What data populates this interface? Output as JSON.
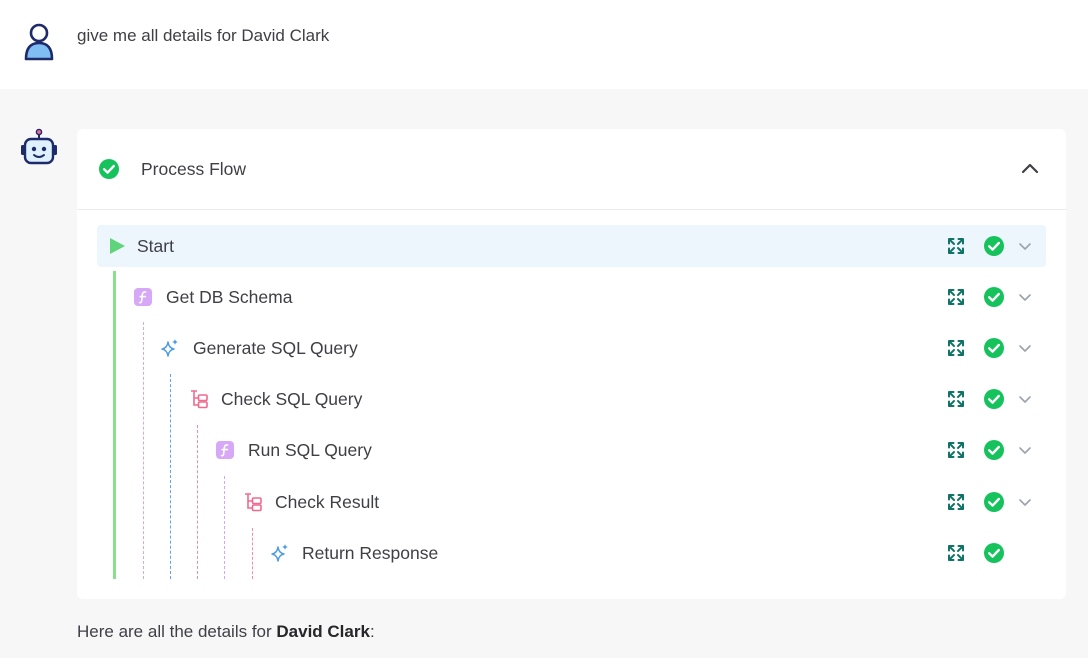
{
  "user_message": {
    "icon": "user-icon",
    "text": "give me all details for David Clark"
  },
  "bot": {
    "icon": "robot-icon"
  },
  "process_flow": {
    "title": "Process Flow",
    "status_icon": "check-circle-icon",
    "collapse_icon": "chevron-up-icon",
    "steps": [
      {
        "label": "Start",
        "icon": "play-icon",
        "status": "completed",
        "has_chevron": true
      },
      {
        "label": "Get DB Schema",
        "icon": "function-icon",
        "status": "completed",
        "has_chevron": true
      },
      {
        "label": "Generate SQL Query",
        "icon": "sparkle-icon",
        "status": "completed",
        "has_chevron": true
      },
      {
        "label": "Check SQL Query",
        "icon": "branch-icon",
        "status": "completed",
        "has_chevron": true
      },
      {
        "label": "Run SQL Query",
        "icon": "function-icon",
        "status": "completed",
        "has_chevron": true
      },
      {
        "label": "Check Result",
        "icon": "branch-icon",
        "status": "completed",
        "has_chevron": true
      },
      {
        "label": "Return Response",
        "icon": "sparkle-icon",
        "status": "completed",
        "has_chevron": false
      }
    ]
  },
  "response": {
    "prefix": "Here are all the details for ",
    "name": "David Clark",
    "suffix": ":"
  },
  "colors": {
    "success": "#16c25c",
    "start_green": "#5fd47a",
    "function_purple": "#d6a8f5",
    "sparkle_blue": "#4f9be6",
    "branch_pink": "#f06a8e",
    "expand_teal": "#0f7466",
    "active_row": "#edf5fd"
  }
}
